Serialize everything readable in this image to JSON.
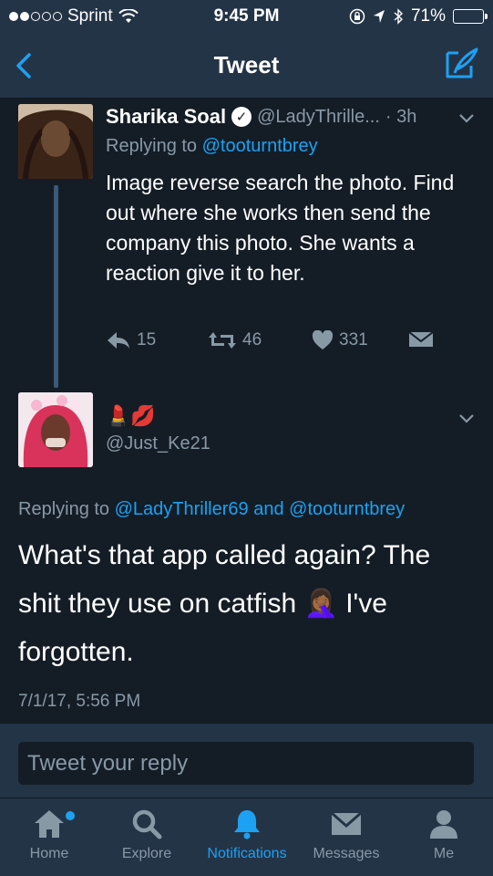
{
  "status_bar": {
    "carrier": "Sprint",
    "time": "9:45 PM",
    "battery": "71%",
    "battery_level": 0.71
  },
  "nav": {
    "title": "Tweet",
    "back_icon": "chevron-left-icon",
    "compose_icon": "compose-tweet-icon"
  },
  "tweet1": {
    "name": "Sharika Soal",
    "handle": "@LadyThrille...",
    "time": "· 3h",
    "replying_prefix": "Replying to ",
    "replying_to": "@tooturntbrey",
    "text": "Image reverse search the  photo. Find out where she works then send the company this photo. She wants a reaction give it to her.",
    "replies": "15",
    "retweets": "46",
    "likes": "331"
  },
  "tweet2": {
    "display_name": "💄💋",
    "handle": "@Just_Ke21",
    "replying_prefix": "Replying to ",
    "replying_to_1": "@LadyThriller69",
    "replying_and": " and ",
    "replying_to_2": "@tooturntbrey",
    "text": "What's that app called again? The shit they use on catfish 🤦🏾‍♀️ I've forgotten.",
    "date": "7/1/17, 5:56 PM"
  },
  "reply_box": {
    "placeholder": "Tweet your reply"
  },
  "tabs": [
    {
      "label": "Home",
      "icon": "home-icon"
    },
    {
      "label": "Explore",
      "icon": "search-icon"
    },
    {
      "label": "Notifications",
      "icon": "bell-icon"
    },
    {
      "label": "Messages",
      "icon": "envelope-icon"
    },
    {
      "label": "Me",
      "icon": "person-icon"
    }
  ],
  "colors": {
    "background": "#141d26",
    "bar": "#243447",
    "accent": "#1da1f2",
    "muted": "#8899a6",
    "battery": "#f5c400"
  }
}
